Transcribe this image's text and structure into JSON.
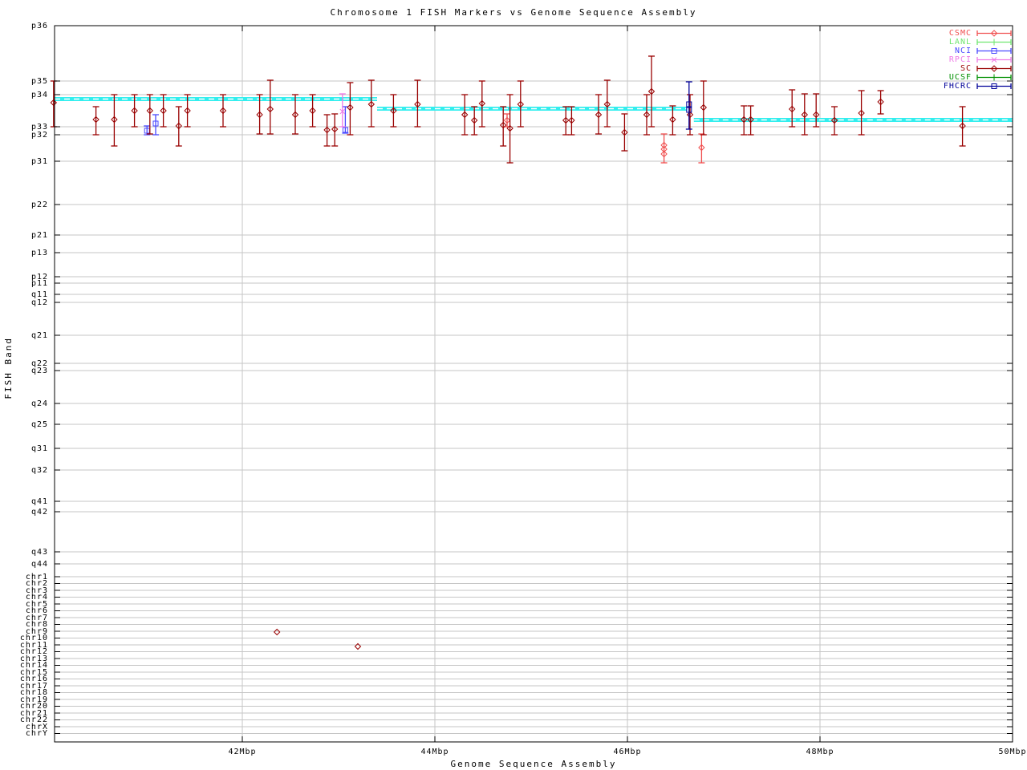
{
  "title": "Chromosome 1 FISH Markers vs Genome Sequence Assembly",
  "axes": {
    "xlabel": "Genome Sequence Assembly",
    "ylabel": "FISH Band"
  },
  "colors": {
    "CSMC": "#f04f4f",
    "LANL": "#6fe66f",
    "NCI": "#4949ff",
    "RPCI": "#ee7ae6",
    "SC": "#990000",
    "UCSF": "#009000",
    "FHCRC": "#000099",
    "assembly_band": "#33eeee",
    "grid": "#c6c6c6",
    "border": "#000000"
  },
  "chart_data": {
    "type": "scatter",
    "title": "Chromosome 1 FISH Markers vs Genome Sequence Assembly",
    "xlabel": "Genome Sequence Assembly",
    "ylabel": "FISH Band",
    "x_unit": "Mbp",
    "xlim": [
      40.05,
      50.0
    ],
    "grid": true,
    "legend_position": "top-right",
    "x_ticks": [
      {
        "label": "42Mbp",
        "mbp": 42
      },
      {
        "label": "44Mbp",
        "mbp": 44
      },
      {
        "label": "46Mbp",
        "mbp": 46
      },
      {
        "label": "48Mbp",
        "mbp": 48
      },
      {
        "label": "50Mbp",
        "mbp": 50
      }
    ],
    "y_ticks": [
      {
        "label": "p36",
        "py": 32
      },
      {
        "label": "p35",
        "py": 101
      },
      {
        "label": "p34",
        "py": 118
      },
      {
        "label": "p33",
        "py": 158
      },
      {
        "label": "p32",
        "py": 168
      },
      {
        "label": "p31",
        "py": 201
      },
      {
        "label": "p22",
        "py": 255
      },
      {
        "label": "p21",
        "py": 293
      },
      {
        "label": "p13",
        "py": 315
      },
      {
        "label": "p12",
        "py": 345
      },
      {
        "label": "p11",
        "py": 353
      },
      {
        "label": "q11",
        "py": 367
      },
      {
        "label": "q12",
        "py": 377
      },
      {
        "label": "q21",
        "py": 418
      },
      {
        "label": "q22",
        "py": 453
      },
      {
        "label": "q23",
        "py": 462
      },
      {
        "label": "q24",
        "py": 503
      },
      {
        "label": "q25",
        "py": 529
      },
      {
        "label": "q31",
        "py": 559
      },
      {
        "label": "q32",
        "py": 586
      },
      {
        "label": "q41",
        "py": 625
      },
      {
        "label": "q42",
        "py": 638
      },
      {
        "label": "q43",
        "py": 688
      },
      {
        "label": "q44",
        "py": 703
      },
      {
        "label": "chr1",
        "py": 719
      },
      {
        "label": "chr2",
        "py": 727.5
      },
      {
        "label": "chr3",
        "py": 736
      },
      {
        "label": "chr4",
        "py": 744.5
      },
      {
        "label": "chr5",
        "py": 753
      },
      {
        "label": "chr6",
        "py": 761.5
      },
      {
        "label": "chr7",
        "py": 770
      },
      {
        "label": "chr8",
        "py": 778.5
      },
      {
        "label": "chr9",
        "py": 787
      },
      {
        "label": "chr10",
        "py": 795.5
      },
      {
        "label": "chr11",
        "py": 804
      },
      {
        "label": "chr12",
        "py": 812.5
      },
      {
        "label": "chr13",
        "py": 821
      },
      {
        "label": "chr14",
        "py": 829.5
      },
      {
        "label": "chr15",
        "py": 838
      },
      {
        "label": "chr16",
        "py": 846.5
      },
      {
        "label": "chr17",
        "py": 855
      },
      {
        "label": "chr18",
        "py": 863.5
      },
      {
        "label": "chr19",
        "py": 872
      },
      {
        "label": "chr20",
        "py": 880.5
      },
      {
        "label": "chr21",
        "py": 889
      },
      {
        "label": "chr22",
        "py": 897.5
      },
      {
        "label": "chrX",
        "py": 906
      },
      {
        "label": "chrY",
        "py": 914.5
      }
    ],
    "assembly_band_segments": [
      {
        "x1_mbp": 40.05,
        "x2_mbp": 43.4,
        "py": 123.5
      },
      {
        "x1_mbp": 43.4,
        "x2_mbp": 46.62,
        "py": 135.5
      },
      {
        "x1_mbp": 46.69,
        "x2_mbp": 50.0,
        "py": 149.5
      }
    ],
    "series": [
      {
        "name": "CSMC",
        "marker": "diamond",
        "points": [
          {
            "mbp": 44.75,
            "py": 150,
            "lo": 158,
            "hi": 142
          },
          {
            "mbp": 46.38,
            "py": 186,
            "lo": 203,
            "hi": 167
          },
          {
            "mbp": 46.38,
            "py": 181
          },
          {
            "mbp": 46.38,
            "py": 192
          },
          {
            "mbp": 46.77,
            "py": 184,
            "lo": 203,
            "hi": 167
          }
        ]
      },
      {
        "name": "LANL",
        "marker": "plus",
        "points": []
      },
      {
        "name": "NCI",
        "marker": "square",
        "points": [
          {
            "mbp": 41.01,
            "py": 163,
            "lo": 168,
            "hi": 157
          },
          {
            "mbp": 41.1,
            "py": 154,
            "lo": 168,
            "hi": 143
          },
          {
            "mbp": 43.07,
            "py": 162,
            "lo": 166,
            "hi": 133
          }
        ]
      },
      {
        "name": "RPCI",
        "marker": "cross",
        "points": [
          {
            "mbp": 43.04,
            "py": 139,
            "lo": 158,
            "hi": 117
          }
        ]
      },
      {
        "name": "SC",
        "marker": "diamond",
        "points": [
          {
            "mbp": 40.04,
            "py": 128,
            "lo": 158,
            "hi": 101
          },
          {
            "mbp": 40.48,
            "py": 149,
            "lo": 168,
            "hi": 133
          },
          {
            "mbp": 40.67,
            "py": 149,
            "lo": 182,
            "hi": 118
          },
          {
            "mbp": 40.88,
            "py": 138,
            "lo": 158,
            "hi": 118
          },
          {
            "mbp": 41.04,
            "py": 138,
            "lo": 167,
            "hi": 118
          },
          {
            "mbp": 41.18,
            "py": 138,
            "lo": 158,
            "hi": 118
          },
          {
            "mbp": 41.34,
            "py": 157,
            "lo": 182,
            "hi": 133
          },
          {
            "mbp": 41.43,
            "py": 138,
            "lo": 158,
            "hi": 118
          },
          {
            "mbp": 41.8,
            "py": 138,
            "lo": 158,
            "hi": 118
          },
          {
            "mbp": 42.18,
            "py": 143,
            "lo": 167,
            "hi": 118
          },
          {
            "mbp": 42.29,
            "py": 136,
            "lo": 167,
            "hi": 100
          },
          {
            "mbp": 42.36,
            "py": 788
          },
          {
            "mbp": 42.55,
            "py": 143,
            "lo": 167,
            "hi": 118
          },
          {
            "mbp": 42.73,
            "py": 138,
            "lo": 158,
            "hi": 118
          },
          {
            "mbp": 42.88,
            "py": 162,
            "lo": 182,
            "hi": 143
          },
          {
            "mbp": 42.96,
            "py": 161,
            "lo": 182,
            "hi": 142
          },
          {
            "mbp": 43.12,
            "py": 134,
            "lo": 168,
            "hi": 103
          },
          {
            "mbp": 43.2,
            "py": 806
          },
          {
            "mbp": 43.34,
            "py": 130,
            "lo": 158,
            "hi": 100
          },
          {
            "mbp": 43.57,
            "py": 138,
            "lo": 158,
            "hi": 118
          },
          {
            "mbp": 43.82,
            "py": 130,
            "lo": 158,
            "hi": 100
          },
          {
            "mbp": 44.31,
            "py": 143,
            "lo": 168,
            "hi": 118
          },
          {
            "mbp": 44.41,
            "py": 150,
            "lo": 168,
            "hi": 133
          },
          {
            "mbp": 44.49,
            "py": 129,
            "lo": 158,
            "hi": 101
          },
          {
            "mbp": 44.71,
            "py": 156,
            "lo": 182,
            "hi": 133
          },
          {
            "mbp": 44.78,
            "py": 160,
            "lo": 203,
            "hi": 118
          },
          {
            "mbp": 44.89,
            "py": 130,
            "lo": 158,
            "hi": 101
          },
          {
            "mbp": 45.36,
            "py": 150,
            "lo": 168,
            "hi": 133
          },
          {
            "mbp": 45.42,
            "py": 150,
            "lo": 168,
            "hi": 133
          },
          {
            "mbp": 45.7,
            "py": 143,
            "lo": 167,
            "hi": 118
          },
          {
            "mbp": 45.79,
            "py": 130,
            "lo": 158,
            "hi": 100
          },
          {
            "mbp": 45.97,
            "py": 165,
            "lo": 188,
            "hi": 142
          },
          {
            "mbp": 46.2,
            "py": 143,
            "lo": 168,
            "hi": 118
          },
          {
            "mbp": 46.25,
            "py": 114,
            "lo": 158,
            "hi": 70
          },
          {
            "mbp": 46.47,
            "py": 149,
            "lo": 168,
            "hi": 132
          },
          {
            "mbp": 46.65,
            "py": 143,
            "lo": 168,
            "hi": 118
          },
          {
            "mbp": 46.79,
            "py": 134,
            "lo": 168,
            "hi": 101
          },
          {
            "mbp": 47.21,
            "py": 149,
            "lo": 168,
            "hi": 132
          },
          {
            "mbp": 47.28,
            "py": 149,
            "lo": 168,
            "hi": 132
          },
          {
            "mbp": 47.71,
            "py": 136,
            "lo": 158,
            "hi": 112
          },
          {
            "mbp": 47.84,
            "py": 143,
            "lo": 168,
            "hi": 117
          },
          {
            "mbp": 47.96,
            "py": 143,
            "lo": 158,
            "hi": 117
          },
          {
            "mbp": 48.15,
            "py": 150,
            "lo": 168,
            "hi": 133
          },
          {
            "mbp": 48.43,
            "py": 141,
            "lo": 168,
            "hi": 113
          },
          {
            "mbp": 48.63,
            "py": 127,
            "lo": 142,
            "hi": 113
          },
          {
            "mbp": 49.48,
            "py": 157,
            "lo": 182,
            "hi": 133
          }
        ]
      },
      {
        "name": "UCSF",
        "marker": "plus",
        "points": []
      },
      {
        "name": "FHCRC",
        "marker": "square",
        "points": [
          {
            "mbp": 46.64,
            "py": 130,
            "lo": 161,
            "hi": 102
          },
          {
            "mbp": 46.64,
            "py": 137
          }
        ]
      }
    ],
    "legend_entries": [
      "CSMC",
      "LANL",
      "NCI",
      "RPCI",
      "SC",
      "UCSF",
      "FHCRC"
    ]
  }
}
